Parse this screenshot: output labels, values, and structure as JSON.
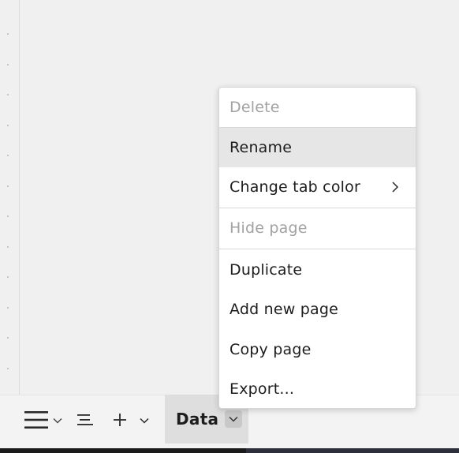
{
  "context_menu": {
    "items": [
      {
        "label": "Delete",
        "enabled": false
      },
      {
        "label": "Rename",
        "enabled": true,
        "highlighted": true
      },
      {
        "label": "Change tab color",
        "enabled": true,
        "has_submenu": true
      },
      {
        "label": "Hide page",
        "enabled": false
      },
      {
        "label": "Duplicate",
        "enabled": true
      },
      {
        "label": "Add new page",
        "enabled": true
      },
      {
        "label": "Copy page",
        "enabled": true
      },
      {
        "label": "Export...",
        "enabled": true
      }
    ]
  },
  "bottom_bar": {
    "active_tab": {
      "label": "Data"
    }
  },
  "icons": {
    "menu": "hamburger-icon",
    "menu_dropdown": "chevron-down-icon",
    "outline": "outline-list-icon",
    "add": "plus-icon",
    "add_dropdown": "chevron-down-icon",
    "tab_dropdown": "chevron-down-icon",
    "submenu": "chevron-right-icon"
  },
  "colors": {
    "canvas": "#f0f0f0",
    "menu_background": "#ffffff",
    "menu_highlight": "#e6e6e6",
    "disabled_text": "#a2a2a2",
    "active_tab": "#dedede"
  }
}
